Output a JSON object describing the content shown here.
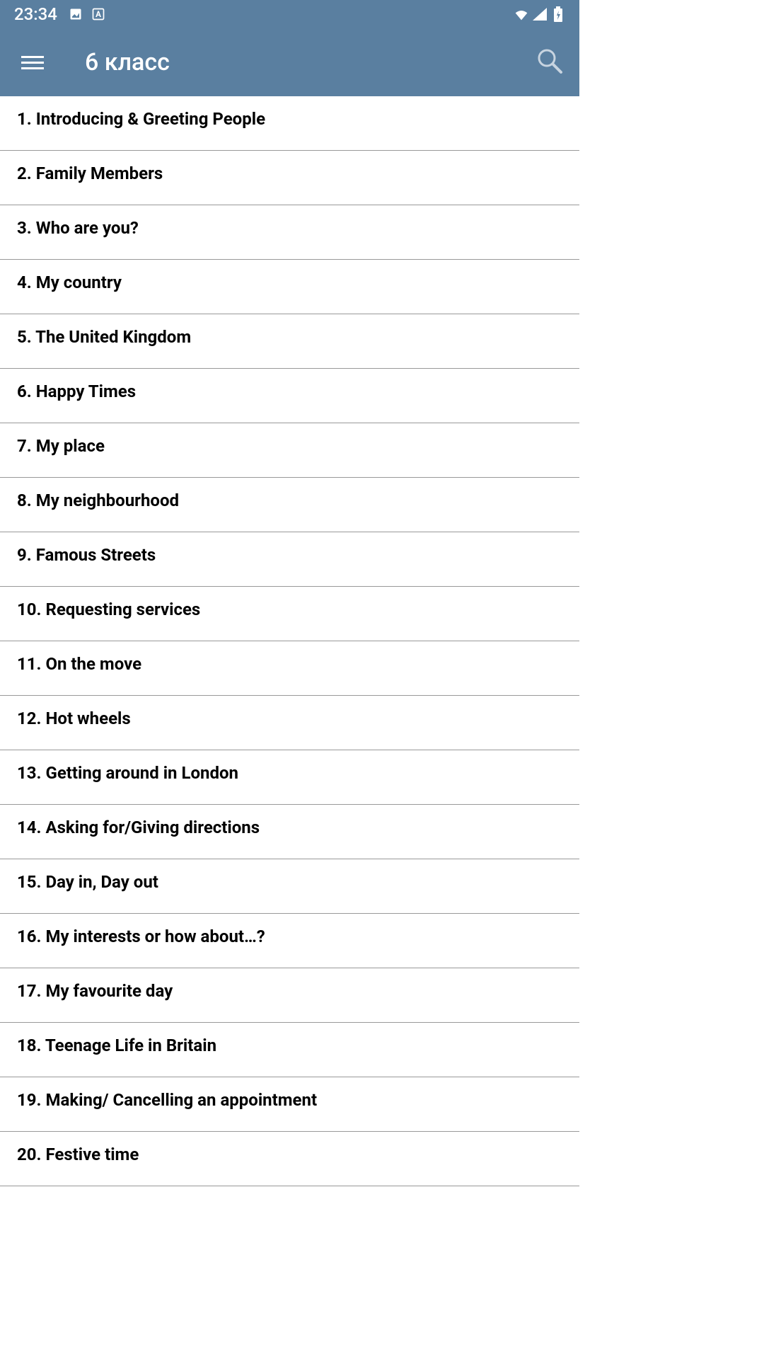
{
  "status_bar": {
    "time": "23:34"
  },
  "app_bar": {
    "title": "6 класс"
  },
  "list_items": [
    "1. Introducing & Greeting People",
    "2. Family Members",
    "3. Who are you?",
    "4. My country",
    "5. The United Kingdom",
    "6. Happy Times",
    "7. My place",
    "8. My neighbourhood",
    "9. Famous Streets",
    "10. Requesting services",
    "11. On the move",
    "12. Hot wheels",
    "13. Getting around in London",
    "14. Asking for/Giving directions",
    "15. Day in, Day out",
    "16. My interests or how about…?",
    "17. My favourite day",
    "18. Teenage Life in Britain",
    "19. Making/ Cancelling an appointment",
    "20. Festive time"
  ]
}
